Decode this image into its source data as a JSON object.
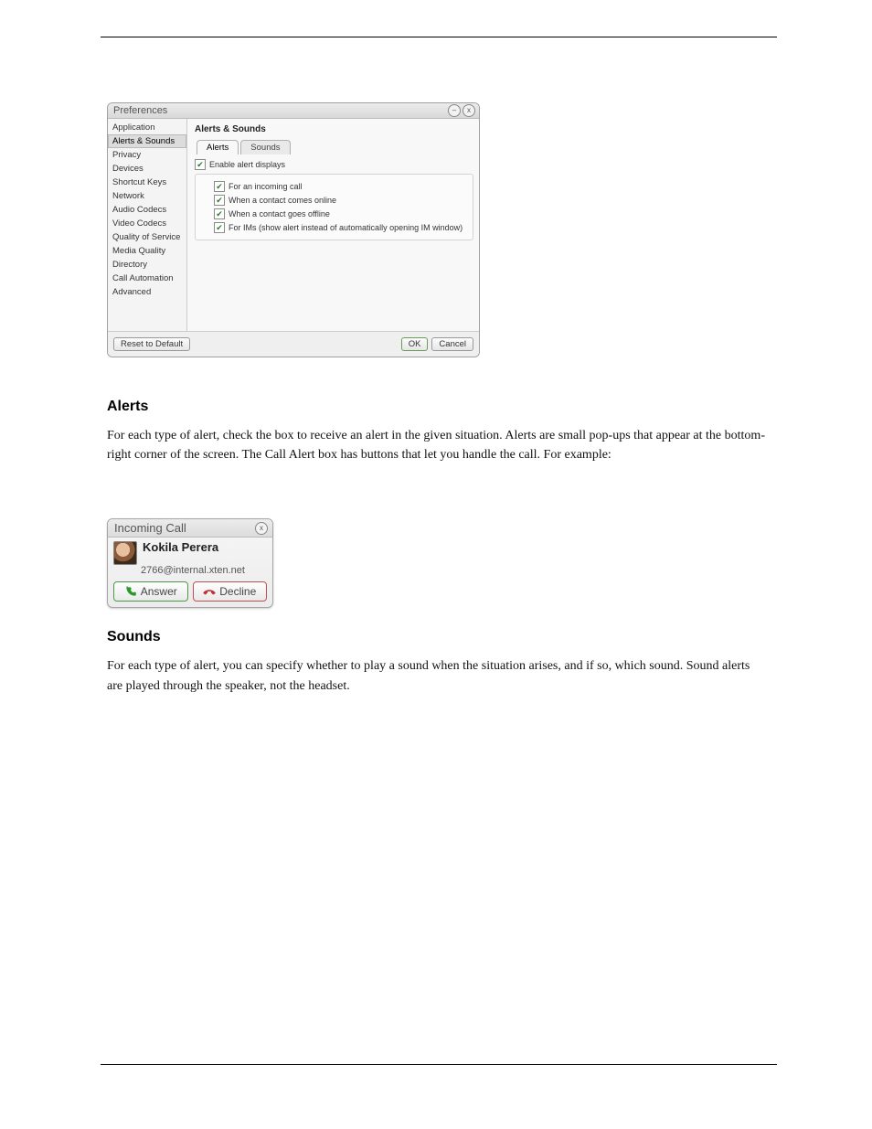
{
  "preferences_window": {
    "title": "Preferences",
    "minimize_icon_label": "–",
    "close_icon_label": "x",
    "sidebar": {
      "items": [
        {
          "label": "Application"
        },
        {
          "label": "Alerts & Sounds",
          "selected": true
        },
        {
          "label": "Privacy"
        },
        {
          "label": "Devices"
        },
        {
          "label": "Shortcut Keys"
        },
        {
          "label": "Network"
        },
        {
          "label": "Audio Codecs"
        },
        {
          "label": "Video Codecs"
        },
        {
          "label": "Quality of Service"
        },
        {
          "label": "Media Quality"
        },
        {
          "label": "Directory"
        },
        {
          "label": "Call Automation"
        },
        {
          "label": "Advanced"
        }
      ]
    },
    "main": {
      "heading": "Alerts & Sounds",
      "tabs": {
        "alerts": "Alerts",
        "sounds": "Sounds"
      },
      "enable_alert_displays": {
        "checked": true,
        "label": "Enable alert displays"
      },
      "alert_options": [
        {
          "checked": true,
          "label": "For an incoming call"
        },
        {
          "checked": true,
          "label": "When a contact comes online"
        },
        {
          "checked": true,
          "label": "When a contact goes offline"
        },
        {
          "checked": true,
          "label": "For IMs (show alert instead of automatically opening IM window)"
        }
      ]
    },
    "footer": {
      "reset": "Reset to Default",
      "ok": "OK",
      "cancel": "Cancel"
    }
  },
  "body_text": {
    "heading_alerts": "Alerts",
    "para1": "For each type of alert, check the box to receive an alert in the given situation. Alerts are small pop-ups that appear at the bottom-right corner of the screen. The Call Alert box has buttons that let you handle the call. For example:",
    "heading_sounds": "Sounds",
    "para2": "For each type of alert, you can specify whether to play a sound when the situation arises, and if so, which sound. Sound alerts are played through the speaker, not the headset."
  },
  "incoming_window": {
    "title": "Incoming Call",
    "close_icon_label": "x",
    "contact_name": "Kokila Perera",
    "contact_address": "2766@internal.xten.net",
    "answer_label": "Answer",
    "decline_label": "Decline"
  }
}
